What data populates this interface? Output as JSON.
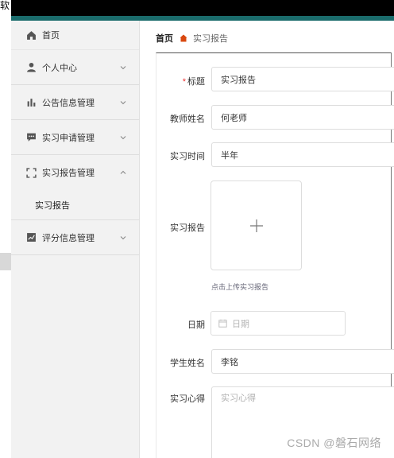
{
  "window": {
    "title_fragment": "软"
  },
  "sidebar": {
    "home": {
      "label": "首页",
      "icon": "home-icon"
    },
    "items": [
      {
        "label": "个人中心",
        "icon": "person-icon",
        "expanded": false
      },
      {
        "label": "公告信息管理",
        "icon": "bar-chart-icon",
        "expanded": false
      },
      {
        "label": "实习申请管理",
        "icon": "message-icon",
        "expanded": false
      },
      {
        "label": "实习报告管理",
        "icon": "fullscreen-icon",
        "expanded": true,
        "children": [
          {
            "label": "实习报告"
          }
        ]
      },
      {
        "label": "评分信息管理",
        "icon": "line-chart-icon",
        "expanded": false
      }
    ]
  },
  "breadcrumb": {
    "home": "首页",
    "separator_icon": "house-icon",
    "current": "实习报告"
  },
  "form": {
    "title": {
      "label": "标题",
      "required_mark": "*",
      "value": "实习报告"
    },
    "teacher": {
      "label": "教师姓名",
      "value": "何老师"
    },
    "duration": {
      "label": "实习时间",
      "value": "半年"
    },
    "report": {
      "label": "实习报告",
      "upload_hint": "点击上传实习报告",
      "icon": "plus-icon"
    },
    "date": {
      "label": "日期",
      "placeholder": "日期",
      "icon": "calendar-icon"
    },
    "student": {
      "label": "学生姓名",
      "value": "李铭"
    },
    "reflection": {
      "label": "实习心得",
      "placeholder": "实习心得"
    }
  },
  "watermark": "CSDN @磐石网络",
  "colors": {
    "accent_teal": "#1a6b6b",
    "breadcrumb_icon": "#d9480f",
    "required": "#e33333"
  }
}
